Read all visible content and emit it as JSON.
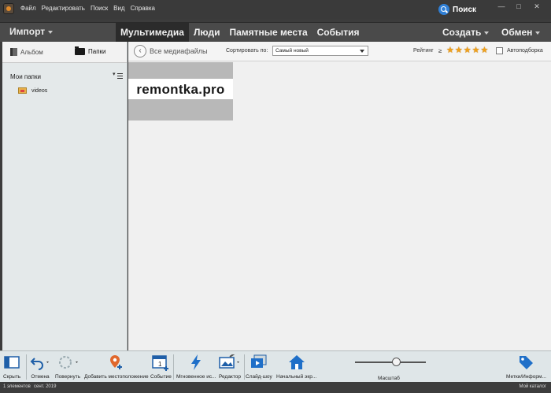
{
  "menu": [
    "Файл",
    "Редактировать",
    "Поиск",
    "Вид",
    "Справка"
  ],
  "search": {
    "label": "Поиск"
  },
  "nav": {
    "import": "Импорт",
    "tabs": [
      "Мультимедиа",
      "Люди",
      "Памятные места",
      "События"
    ],
    "active_tab": "Мультимедиа",
    "create": "Создать",
    "share": "Обмен"
  },
  "sidebar": {
    "tabs": {
      "album": "Альбом",
      "folders": "Папки"
    },
    "active_tab": "Папки",
    "my_folders": "Мои папки",
    "folders": [
      {
        "name": "videos"
      }
    ]
  },
  "content": {
    "back_label": "Все медиафайлы",
    "sort_label": "Сортировать по:",
    "sort_value": "Самый новый",
    "rating_label": "Рейтинг",
    "rating_op": "≥",
    "rating_stars": 5,
    "auto_label": "Автоподборка",
    "auto_checked": false,
    "thumbnail": {
      "text": "remontka.pro"
    }
  },
  "toolbar": {
    "hide": "Скрыть",
    "undo": "Отмена",
    "rotate": "Повернуть",
    "add_place": "Добавить местоположение",
    "event": "Событие",
    "instant_fix": "Мгновенное ис...",
    "editor": "Редактор",
    "slideshow": "Слайд-шоу",
    "home": "Начальный экр...",
    "zoom": "Масштаб",
    "zoom_level": 0.58,
    "tags": "Метки/Информ..."
  },
  "status": {
    "count": "1 элементов",
    "date": "сент. 2019",
    "catalog": "Мой каталог"
  },
  "colors": {
    "accent": "#2f7fd6",
    "star": "#f0a11a",
    "pin": "#e0672c"
  }
}
